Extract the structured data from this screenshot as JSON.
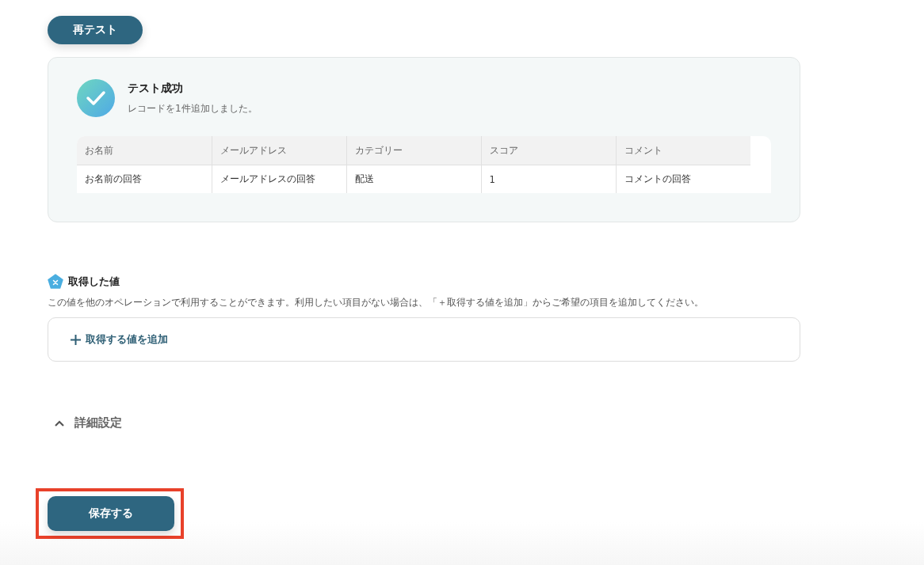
{
  "retest_button": {
    "label": "再テスト"
  },
  "result": {
    "title": "テスト成功",
    "message": "レコードを1件追加しました。",
    "table": {
      "columns": [
        "お名前",
        "メールアドレス",
        "カテゴリー",
        "スコア",
        "コメント"
      ],
      "rows": [
        [
          "お名前の回答",
          "メールアドレスの回答",
          "配送",
          "1",
          "コメントの回答"
        ]
      ]
    }
  },
  "acquired_values": {
    "title": "取得した値",
    "description": "この値を他のオペレーションで利用することができます。利用したい項目がない場合は、「＋取得する値を追加」からご希望の項目を追加してください。",
    "add_button": "取得する値を追加"
  },
  "advanced_settings": {
    "label": "詳細設定",
    "expanded": true
  },
  "save_button": {
    "label": "保存する",
    "highlighted": true
  }
}
